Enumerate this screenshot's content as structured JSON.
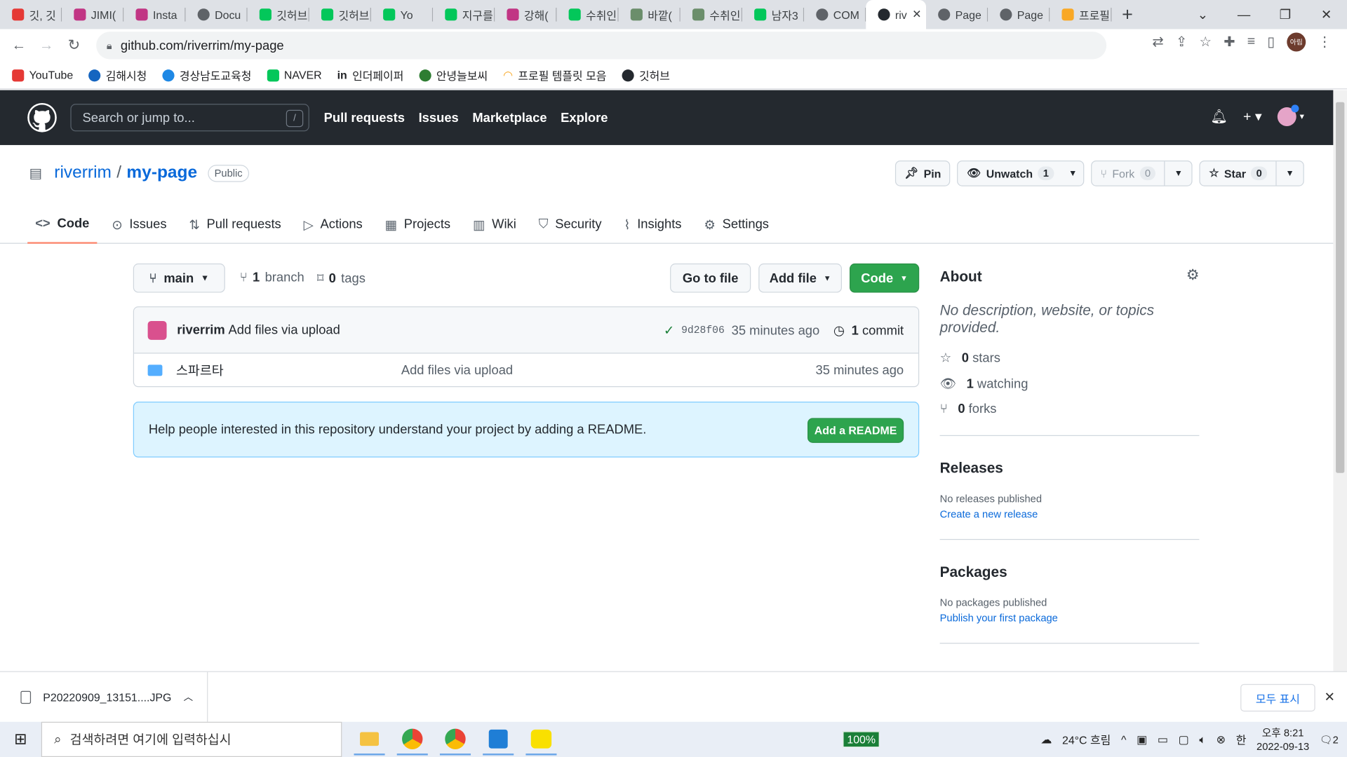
{
  "browser": {
    "tabs": [
      {
        "label": "깃, 깃",
        "color": "#e53935"
      },
      {
        "label": "JIMI(",
        "color": "#c13584"
      },
      {
        "label": "Insta",
        "color": "#c13584"
      },
      {
        "label": "Docu",
        "color": "#5f6368"
      },
      {
        "label": "깃허브",
        "color": "#03c75a"
      },
      {
        "label": "깃허브",
        "color": "#03c75a"
      },
      {
        "label": "Yo",
        "color": "#03c75a"
      },
      {
        "label": "지구를",
        "color": "#03c75a"
      },
      {
        "label": "강해(",
        "color": "#c13584"
      },
      {
        "label": "수취인",
        "color": "#03c75a"
      },
      {
        "label": "바깥(",
        "color": "#6b8e6b"
      },
      {
        "label": "수취인",
        "color": "#6b8e6b"
      },
      {
        "label": "남자3",
        "color": "#03c75a"
      },
      {
        "label": "COM",
        "color": "#5f6368"
      },
      {
        "label": "riv",
        "color": "#24292f",
        "active": true
      },
      {
        "label": "Page",
        "color": "#5f6368"
      },
      {
        "label": "Page",
        "color": "#5f6368"
      },
      {
        "label": "프로필",
        "color": "#f9a825"
      }
    ],
    "url": "github.com/riverrim/my-page",
    "profile_initials": "아림",
    "bookmarks": [
      {
        "label": "YouTube",
        "color": "#e53935"
      },
      {
        "label": "김해시청",
        "color": "#1565c0"
      },
      {
        "label": "경상남도교육청",
        "color": "#1e88e5"
      },
      {
        "label": "NAVER",
        "color": "#03c75a"
      },
      {
        "label": "인더페이퍼",
        "color": "#333333"
      },
      {
        "label": "안녕늘보씨",
        "color": "#2e7d32"
      },
      {
        "label": "프로필 템플릿 모음",
        "color": "#f9a825"
      },
      {
        "label": "깃허브",
        "color": "#24292f"
      }
    ]
  },
  "github": {
    "search_placeholder": "Search or jump to...",
    "search_key": "/",
    "nav": [
      "Pull requests",
      "Issues",
      "Marketplace",
      "Explore"
    ],
    "owner": "riverrim",
    "repo": "my-page",
    "visibility": "Public",
    "pin_label": "Pin",
    "unwatch_label": "Unwatch",
    "unwatch_count": "1",
    "fork_label": "Fork",
    "fork_count": "0",
    "star_label": "Star",
    "star_count": "0",
    "tabs": [
      "Code",
      "Issues",
      "Pull requests",
      "Actions",
      "Projects",
      "Wiki",
      "Security",
      "Insights",
      "Settings"
    ],
    "branch": "main",
    "branch_count": "1",
    "branch_word": "branch",
    "tag_count": "0",
    "tag_word": "tags",
    "go_to_file": "Go to file",
    "add_file": "Add file",
    "code_button": "Code",
    "commit": {
      "author": "riverrim",
      "message": "Add files via upload",
      "sha": "9d28f06",
      "time": "35 minutes ago",
      "count": "1",
      "count_word": "commit"
    },
    "files": [
      {
        "name": "스파르타",
        "message": "Add files via upload",
        "time": "35 minutes ago"
      }
    ],
    "readme_text": "Help people interested in this repository understand your project by adding a README.",
    "readme_button": "Add a README",
    "about": {
      "title": "About",
      "description": "No description, website, or topics provided.",
      "stars_count": "0",
      "stars_word": "stars",
      "watching_count": "1",
      "watching_word": "watching",
      "forks_count": "0",
      "forks_word": "forks"
    },
    "releases": {
      "title": "Releases",
      "note": "No releases published",
      "link": "Create a new release"
    },
    "packages": {
      "title": "Packages",
      "note": "No packages published",
      "link": "Publish your first package"
    }
  },
  "downloads": {
    "file": "P20220909_13151....JPG",
    "show_all": "모두 표시"
  },
  "taskbar": {
    "search_placeholder": "검색하려면 여기에 입력하십시",
    "zoom": "100%",
    "weather": "24°C 흐림",
    "ime": "한",
    "time": "오후 8:21",
    "date": "2022-09-13",
    "notifications": "2"
  }
}
